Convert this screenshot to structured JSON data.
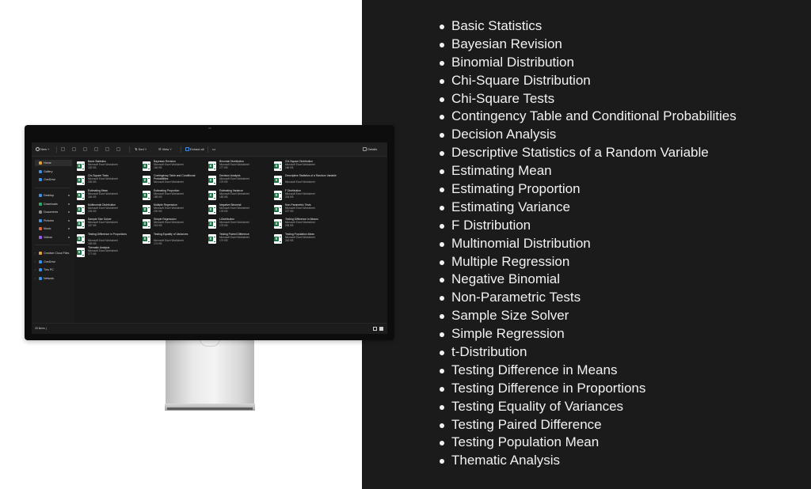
{
  "explorer": {
    "toolbar": {
      "new_label": "New",
      "sort_label": "Sort",
      "view_label": "View",
      "extract_label": "Extract all",
      "more_label": "•••",
      "details_label": "Details"
    },
    "nav": {
      "top": [
        {
          "label": "Home",
          "icon": "home-icon",
          "color": "#e0a040"
        },
        {
          "label": "Gallery",
          "icon": "gallery-icon",
          "color": "#3a8ee6"
        },
        {
          "label": "OneDrive",
          "icon": "cloud-icon",
          "color": "#3a8ee6"
        }
      ],
      "pinned": [
        {
          "label": "Desktop",
          "icon": "desktop-icon",
          "color": "#3a8ee6"
        },
        {
          "label": "Downloads",
          "icon": "download-icon",
          "color": "#2fa66b"
        },
        {
          "label": "Documents",
          "icon": "documents-icon",
          "color": "#8a8a8a"
        },
        {
          "label": "Pictures",
          "icon": "pictures-icon",
          "color": "#3a8ee6"
        },
        {
          "label": "Music",
          "icon": "music-icon",
          "color": "#e0603a"
        },
        {
          "label": "Videos",
          "icon": "videos-icon",
          "color": "#9a5de0"
        }
      ],
      "bottom": [
        {
          "label": "Creative Cloud Files",
          "icon": "folder-icon",
          "color": "#e0a040"
        },
        {
          "label": "OneDrive",
          "icon": "cloud-icon",
          "color": "#3a8ee6"
        },
        {
          "label": "This PC",
          "icon": "pc-icon",
          "color": "#3a8ee6"
        },
        {
          "label": "Network",
          "icon": "network-icon",
          "color": "#3a8ee6"
        }
      ]
    },
    "files": [
      {
        "name": "Basic Statistics",
        "type": "Microsoft Excel Worksheet",
        "size": "183 KB"
      },
      {
        "name": "Bayesian Revision",
        "type": "Microsoft Excel Worksheet",
        "size": "166 KB"
      },
      {
        "name": "Binomial Distribution",
        "type": "Microsoft Excel Worksheet",
        "size": "177 KB"
      },
      {
        "name": "Chi-Square Distribution",
        "type": "Microsoft Excel Worksheet",
        "size": "166 KB"
      },
      {
        "name": "Chi-Square Tests",
        "type": "Microsoft Excel Worksheet",
        "size": "183 KB"
      },
      {
        "name": "Contingency Table and Conditional Probabilities",
        "type": "Microsoft Excel Worksheet",
        "size": ""
      },
      {
        "name": "Decision Analysis",
        "type": "Microsoft Excel Worksheet",
        "size": "175 KB"
      },
      {
        "name": "Descriptive Statistics of a Random Variable",
        "type": "Microsoft Excel Worksheet",
        "size": ""
      },
      {
        "name": "Estimating Mean",
        "type": "Microsoft Excel Worksheet",
        "size": "184 KB"
      },
      {
        "name": "Estimating Proportion",
        "type": "Microsoft Excel Worksheet",
        "size": "185 KB"
      },
      {
        "name": "Estimating Variance",
        "type": "Microsoft Excel Worksheet",
        "size": "183 KB"
      },
      {
        "name": "F Distribution",
        "type": "Microsoft Excel Worksheet",
        "size": "204 KB"
      },
      {
        "name": "Multinomial Distribution",
        "type": "Microsoft Excel Worksheet",
        "size": "194 KB"
      },
      {
        "name": "Multiple Regression",
        "type": "Microsoft Excel Worksheet",
        "size": "200 KB"
      },
      {
        "name": "Negative Binomial",
        "type": "Microsoft Excel Worksheet",
        "size": "178 KB"
      },
      {
        "name": "Non-Parametric Tests",
        "type": "Microsoft Excel Worksheet",
        "size": "227 KB"
      },
      {
        "name": "Sample Size Solver",
        "type": "Microsoft Excel Worksheet",
        "size": "187 KB"
      },
      {
        "name": "Simple Regression",
        "type": "Microsoft Excel Worksheet",
        "size": "215 KB"
      },
      {
        "name": "t-Distribution",
        "type": "Microsoft Excel Worksheet",
        "size": "175 KB"
      },
      {
        "name": "Testing Difference in Means",
        "type": "Microsoft Excel Worksheet",
        "size": "206 KB"
      },
      {
        "name": "Testing Difference in Proportions",
        "type": "Microsoft Excel Worksheet",
        "size": "183 KB"
      },
      {
        "name": "Testing Equality of Variances",
        "type": "Microsoft Excel Worksheet",
        "size": "174 KB"
      },
      {
        "name": "Testing Paired Difference",
        "type": "Microsoft Excel Worksheet",
        "size": "174 KB"
      },
      {
        "name": "Testing Population Mean",
        "type": "Microsoft Excel Worksheet",
        "size": "240 KB"
      },
      {
        "name": "Thematic Analysis",
        "type": "Microsoft Excel Worksheet",
        "size": "177 KB"
      }
    ],
    "status": "25 items  |"
  },
  "topics": [
    "Basic Statistics",
    "Bayesian Revision",
    "Binomial Distribution",
    "Chi-Square Distribution",
    "Chi-Square Tests",
    "Contingency Table and Conditional Probabilities",
    "Decision Analysis",
    "Descriptive Statistics of a Random Variable",
    "Estimating Mean",
    "Estimating Proportion",
    "Estimating Variance",
    "F Distribution",
    "Multinomial Distribution",
    "Multiple Regression",
    "Negative Binomial",
    "Non-Parametric Tests",
    "Sample Size Solver",
    "Simple Regression",
    "t-Distribution",
    "Testing Difference in Means",
    "Testing Difference in Proportions",
    "Testing Equality of Variances",
    "Testing Paired Difference",
    "Testing Population Mean",
    "Thematic Analysis"
  ]
}
